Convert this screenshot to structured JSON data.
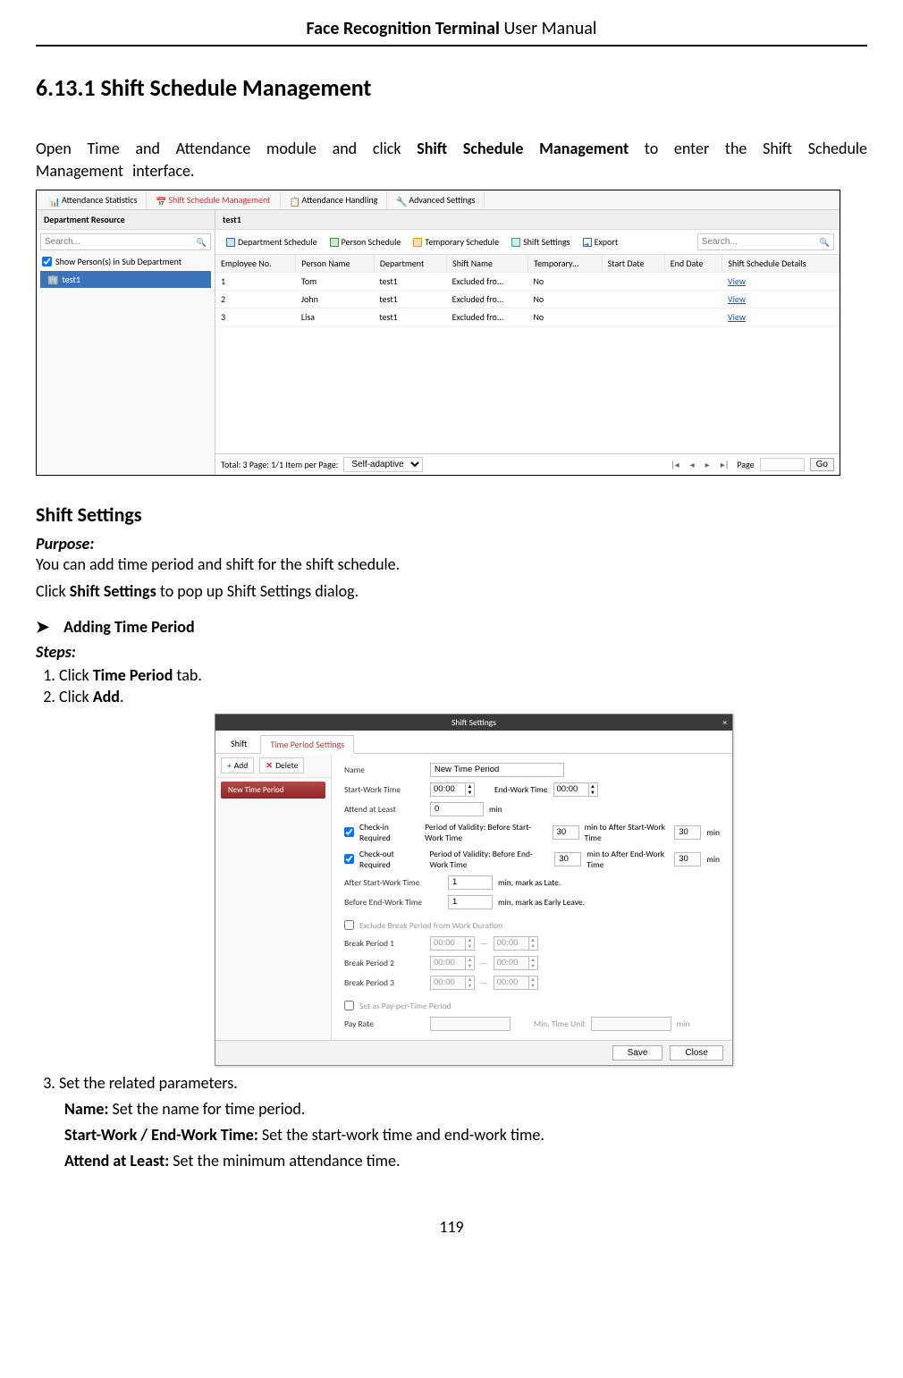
{
  "doc": {
    "header_bold": "Face Recognition Terminal",
    "header_rest": " User Manual",
    "page_number": "119",
    "section_no": "6.13.1",
    "section_title": "Shift Schedule Management",
    "intro_a": "Open Time and Attendance module and click ",
    "intro_bold": "Shift Schedule Management",
    "intro_b": " to enter the Shift Schedule Management interface.",
    "h3_shift_settings": "Shift Settings",
    "purpose_label": "Purpose:",
    "purpose_text": "You can add time period and shift for the shift schedule.",
    "click_shift_a": "Click ",
    "click_shift_bold": "Shift Settings",
    "click_shift_b": " to pop up Shift Settings dialog.",
    "adding_tp": "Adding Time Period",
    "steps_label": "Steps:",
    "step1_a": "Click ",
    "step1_bold": "Time Period",
    "step1_b": " tab.",
    "step2_a": "Click ",
    "step2_bold": "Add",
    "step2_b": ".",
    "step3": "Set the related parameters.",
    "p_name_label": "Name:",
    "p_name_text": " Set the name for time period.",
    "p_startend_label": "Start-Work / End-Work Time:",
    "p_startend_text": " Set the start-work time and end-work time.",
    "p_attend_label": "Attend at Least:",
    "p_attend_text": " Set the minimum attendance time."
  },
  "app": {
    "tabs": {
      "stats": "Attendance Statistics",
      "ssm": "Shift Schedule Management",
      "handling": "Attendance Handling",
      "advanced": "Advanced Settings"
    },
    "sidebar": {
      "title": "Department Resource",
      "search_ph": "Search...",
      "show_sub": "Show Person(s) in Sub Department",
      "tree_root": "test1"
    },
    "main": {
      "title": "test1",
      "toolbar": {
        "dept": "Department Schedule",
        "person": "Person Schedule",
        "temp": "Temporary Schedule",
        "shift": "Shift Settings",
        "export": "Export",
        "search_ph": "Search..."
      },
      "columns": {
        "empno": "Employee No.",
        "pname": "Person Name",
        "dept": "Department",
        "sname": "Shift Name",
        "temp": "Temporary...",
        "sdate": "Start Date",
        "edate": "End Date",
        "details": "Shift Schedule Details"
      },
      "rows": [
        {
          "no": "1",
          "name": "Tom",
          "dept": "test1",
          "shift": "Excluded fro...",
          "temp": "No",
          "view": "View"
        },
        {
          "no": "2",
          "name": "John",
          "dept": "test1",
          "shift": "Excluded fro...",
          "temp": "No",
          "view": "View"
        },
        {
          "no": "3",
          "name": "Lisa",
          "dept": "test1",
          "shift": "Excluded fro...",
          "temp": "No",
          "view": "View"
        }
      ],
      "pager": {
        "total": "Total: 3  Page: 1/1  Item per Page:",
        "mode": "Self-adaptive",
        "page_label": "Page",
        "go": "Go"
      }
    }
  },
  "dialog": {
    "title": "Shift Settings",
    "tabs": {
      "shift": "Shift",
      "tp": "Time Period Settings"
    },
    "left": {
      "add": "Add",
      "delete": "Delete",
      "item": "New Time Period"
    },
    "fields": {
      "name_lbl": "Name",
      "name_val": "New Time Period",
      "start_lbl": "Start-Work Time",
      "start_val": "00:00",
      "end_lbl": "End-Work Time",
      "end_val": "00:00",
      "attend_lbl": "Attend at Least",
      "attend_val": "0",
      "min": "min",
      "checkin": "Check-in Required",
      "pov_a": "Period of Validity:  Before Start-Work Time",
      "pov_av": "30",
      "pov_mid": "min  to  After Start-Work Time",
      "pov_bv": "30",
      "checkout": "Check-out Required",
      "pov2_a": "Period of Validity:  Before End-Work Time",
      "pov2_av": "30",
      "pov2_mid": "min  to  After End-Work Time",
      "pov2_bv": "30",
      "afterstart_lbl": "After Start-Work Time",
      "afterstart_val": "1",
      "afterstart_txt": "min,  mark as Late.",
      "beforeend_lbl": "Before End-Work Time",
      "beforeend_val": "1",
      "beforeend_txt": "min,  mark as Early Leave.",
      "exclude": "Exclude Break Period from Work Duration",
      "bp1": "Break Period 1",
      "bp2": "Break Period 2",
      "bp3": "Break Period 3",
      "bpv": "00:00",
      "dash": "—",
      "setpay": "Set as Pay-per-Time Period",
      "payrate": "Pay Rate",
      "mintime": "Min. Time Unit"
    },
    "footer": {
      "save": "Save",
      "close": "Close"
    }
  }
}
